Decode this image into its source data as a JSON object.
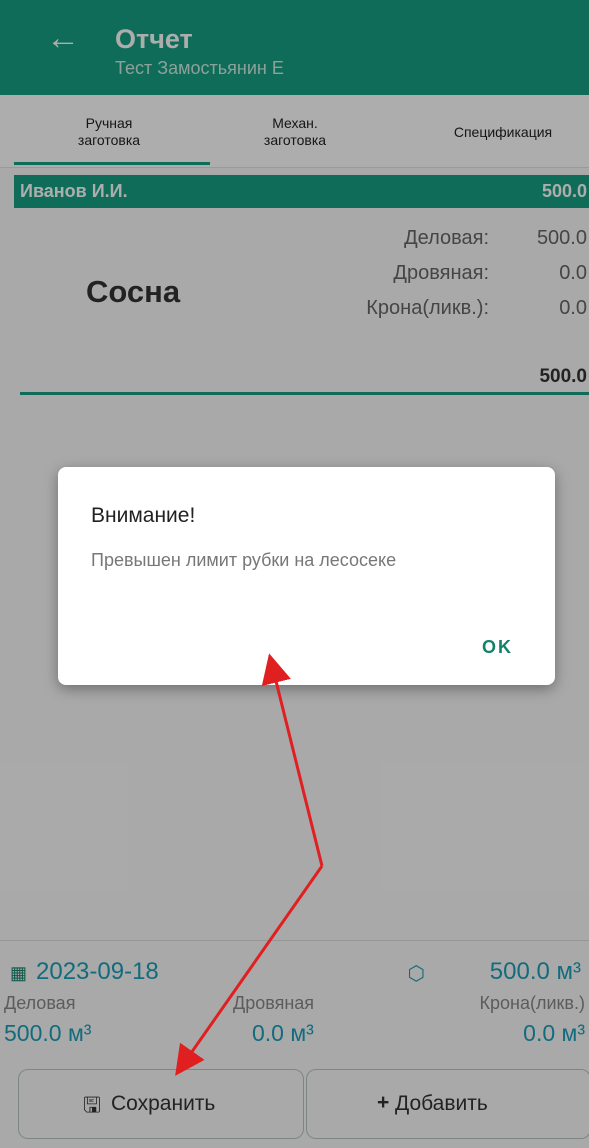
{
  "header": {
    "title": "Отчет",
    "subtitle": "Тест Замостьянин Е",
    "back_icon": "←"
  },
  "tabs": [
    {
      "line1": "Ручная",
      "line2": "заготовка"
    },
    {
      "line1": "Механ.",
      "line2": "заготовка"
    },
    {
      "line1": "Спецификация",
      "line2": ""
    }
  ],
  "record": {
    "worker": "Иванов И.И.",
    "worker_total": "500.0",
    "species": "Сосна",
    "rows": [
      {
        "label": "Деловая:",
        "value": "500.0"
      },
      {
        "label": "Дровяная:",
        "value": "0.0"
      },
      {
        "label": "Крона(ликв.):",
        "value": "0.0"
      }
    ],
    "total": "500.0"
  },
  "dialog": {
    "title": "Внимание!",
    "message": "Превышен лимит рубки на лесосеке",
    "ok_label": "OK"
  },
  "footer": {
    "date": "2023-09-18",
    "total": "500.0 м³",
    "columns": [
      {
        "label": "Деловая",
        "value": "500.0 м³"
      },
      {
        "label": "Дровяная",
        "value": "0.0 м³"
      },
      {
        "label": "Крона(ликв.)",
        "value": "0.0 м³"
      }
    ],
    "save_label": "Сохранить",
    "add_label": "Добавить"
  },
  "colors": {
    "accent": "#17a082",
    "value_blue": "#1b9fb8",
    "arrow": "#e02020"
  }
}
